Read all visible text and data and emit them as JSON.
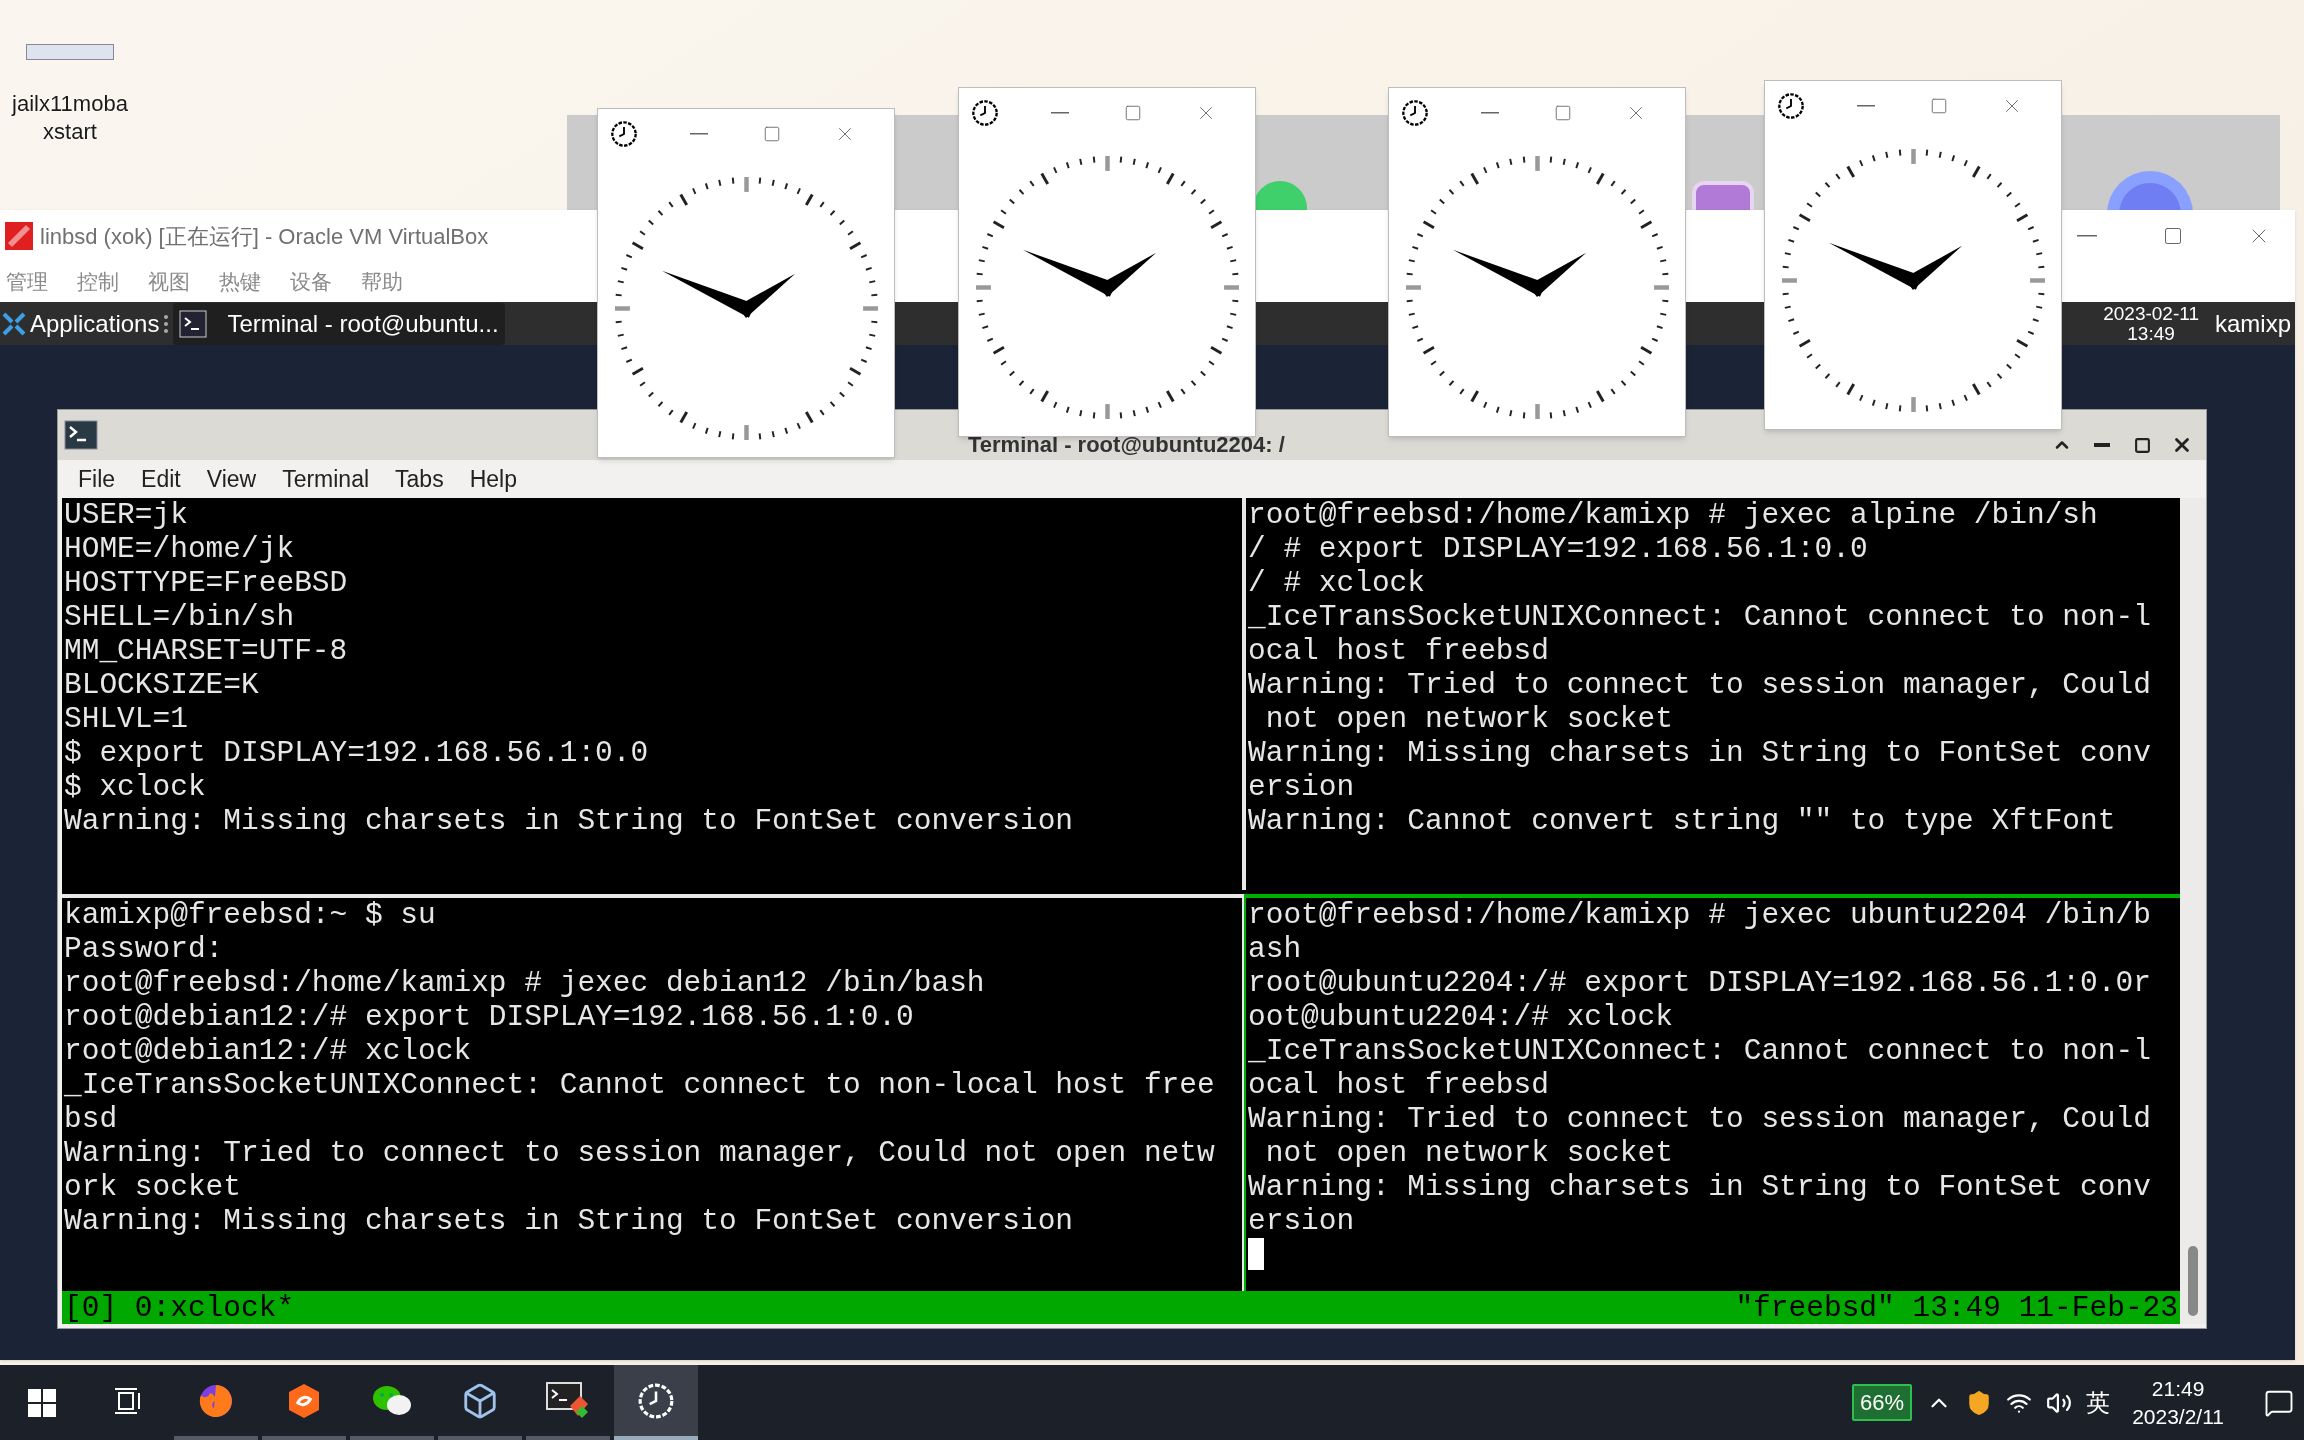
{
  "desktop_icons": [
    {
      "label": "jailx11moba xstart"
    }
  ],
  "virtualbox": {
    "title": "linbsd (xok) [正在运行] - Oracle VM VirtualBox",
    "menu": [
      "管理",
      "控制",
      "视图",
      "热键",
      "设备",
      "帮助"
    ]
  },
  "guest_panel": {
    "applications": "Applications",
    "tasks": [
      {
        "label": "Terminal - root@ubuntu...",
        "selected": true
      }
    ],
    "date": "2023-02-11",
    "time": "13:49",
    "user": "kamixp"
  },
  "terminal": {
    "title": "Terminal - root@ubuntu2204: /",
    "menu": [
      "File",
      "Edit",
      "View",
      "Terminal",
      "Tabs",
      "Help"
    ],
    "panes": [
      {
        "active": false,
        "lines": [
          "USER=jk",
          "HOME=/home/jk",
          "HOSTTYPE=FreeBSD",
          "SHELL=/bin/sh",
          "MM_CHARSET=UTF-8",
          "BLOCKSIZE=K",
          "SHLVL=1",
          "$ export DISPLAY=192.168.56.1:0.0",
          "$ xclock",
          "Warning: Missing charsets in String to FontSet conversion"
        ]
      },
      {
        "active": false,
        "lines": [
          "root@freebsd:/home/kamixp # jexec alpine /bin/sh",
          "/ # export DISPLAY=192.168.56.1:0.0",
          "/ # xclock",
          "_IceTransSocketUNIXConnect: Cannot connect to non-l",
          "ocal host freebsd",
          "Warning: Tried to connect to session manager, Could",
          " not open network socket",
          "Warning: Missing charsets in String to FontSet conv",
          "ersion",
          "Warning: Cannot convert string \"\" to type XftFont"
        ]
      },
      {
        "active": false,
        "lines": [
          "kamixp@freebsd:~ $ su",
          "Password:",
          "root@freebsd:/home/kamixp # jexec debian12 /bin/bash",
          "root@debian12:/# export DISPLAY=192.168.56.1:0.0",
          "root@debian12:/# xclock",
          "_IceTransSocketUNIXConnect: Cannot connect to non-local host free",
          "bsd",
          "Warning: Tried to connect to session manager, Could not open netw",
          "ork socket",
          "Warning: Missing charsets in String to FontSet conversion"
        ]
      },
      {
        "active": true,
        "lines": [
          "root@freebsd:/home/kamixp # jexec ubuntu2204 /bin/b",
          "ash",
          "root@ubuntu2204:/# export DISPLAY=192.168.56.1:0.0r",
          "oot@ubuntu2204:/# xclock",
          "_IceTransSocketUNIXConnect: Cannot connect to non-l",
          "ocal host freebsd",
          "Warning: Tried to connect to session manager, Could",
          " not open network socket",
          "Warning: Missing charsets in String to FontSet conv",
          "ersion"
        ]
      }
    ],
    "status_left": "[0] 0:xclock*",
    "status_right": "\"freebsd\" 13:49 11-Feb-23"
  },
  "taskbar": {
    "apps": [
      {
        "kind": "taskview",
        "selected": false
      },
      {
        "kind": "browser",
        "selected": false
      },
      {
        "kind": "orange",
        "selected": false
      },
      {
        "kind": "chat",
        "selected": false
      },
      {
        "kind": "cube",
        "selected": false
      },
      {
        "kind": "terminal",
        "selected": false
      },
      {
        "kind": "clock",
        "selected": true
      }
    ],
    "battery": "66%",
    "ime": "英",
    "time": "21:49",
    "date": "2023/2/11"
  }
}
